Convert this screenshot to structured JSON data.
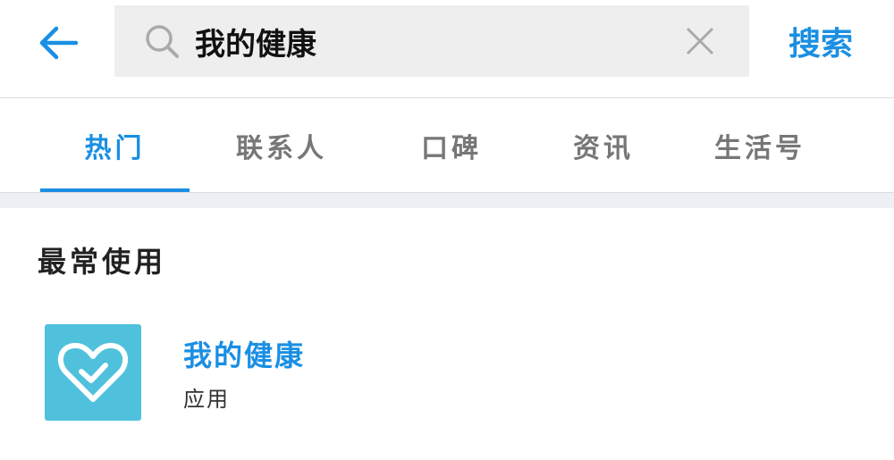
{
  "header": {
    "back_icon": "back-arrow-icon",
    "search": {
      "value": "我的健康",
      "placeholder": "",
      "search_icon": "search-icon",
      "clear_icon": "close-icon"
    },
    "search_button_label": "搜索"
  },
  "tabs": [
    {
      "label": "热门",
      "active": true
    },
    {
      "label": "联系人",
      "active": false
    },
    {
      "label": "口碑",
      "active": false
    },
    {
      "label": "资讯",
      "active": false
    },
    {
      "label": "生活号",
      "active": false
    }
  ],
  "section": {
    "title": "最常使用",
    "results": [
      {
        "name": "我的健康",
        "type": "应用",
        "icon": "heart-check-icon"
      }
    ]
  },
  "colors": {
    "accent": "#1a8fe3",
    "app_icon_bg": "#4fc1dd",
    "search_bg": "#eeeeee",
    "divider_bg": "#eeeff5"
  }
}
